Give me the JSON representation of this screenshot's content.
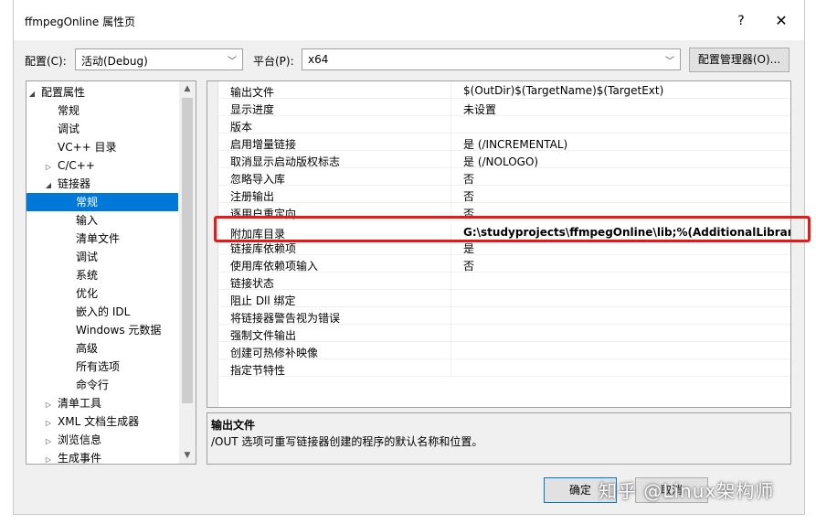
{
  "window": {
    "title": "ffmpegOnline 属性页",
    "help_glyph": "?",
    "close_glyph": "✕"
  },
  "config_bar": {
    "config_label": "配置(C):",
    "config_value": "活动(Debug)",
    "platform_label": "平台(P):",
    "platform_value": "x64",
    "manager_button": "配置管理器(O)..."
  },
  "tree": {
    "items": [
      {
        "label": "配置属性",
        "toggle": "◢"
      },
      {
        "label": "常规",
        "toggle": ""
      },
      {
        "label": "调试",
        "toggle": ""
      },
      {
        "label": "VC++ 目录",
        "toggle": ""
      },
      {
        "label": "C/C++",
        "toggle": "▷"
      },
      {
        "label": "链接器",
        "toggle": "◢"
      },
      {
        "label": "常规",
        "toggle": ""
      },
      {
        "label": "输入",
        "toggle": ""
      },
      {
        "label": "清单文件",
        "toggle": ""
      },
      {
        "label": "调试",
        "toggle": ""
      },
      {
        "label": "系统",
        "toggle": ""
      },
      {
        "label": "优化",
        "toggle": ""
      },
      {
        "label": "嵌入的 IDL",
        "toggle": ""
      },
      {
        "label": "Windows 元数据",
        "toggle": ""
      },
      {
        "label": "高级",
        "toggle": ""
      },
      {
        "label": "所有选项",
        "toggle": ""
      },
      {
        "label": "命令行",
        "toggle": ""
      },
      {
        "label": "清单工具",
        "toggle": "▷"
      },
      {
        "label": "XML 文档生成器",
        "toggle": "▷"
      },
      {
        "label": "浏览信息",
        "toggle": "▷"
      },
      {
        "label": "生成事件",
        "toggle": "▷"
      }
    ],
    "selected_index": 6
  },
  "properties": {
    "rows": [
      {
        "name": "输出文件",
        "value": "$(OutDir)$(TargetName)$(TargetExt)"
      },
      {
        "name": "显示进度",
        "value": "未设置"
      },
      {
        "name": "版本",
        "value": ""
      },
      {
        "name": "启用增量链接",
        "value": "是 (/INCREMENTAL)"
      },
      {
        "name": "取消显示启动版权标志",
        "value": "是 (/NOLOGO)"
      },
      {
        "name": "忽略导入库",
        "value": "否"
      },
      {
        "name": "注册输出",
        "value": "否"
      },
      {
        "name": "逐用户重定向",
        "value": "否"
      },
      {
        "name": "附加库目录",
        "value": "G:\\studyprojects\\ffmpegOnline\\lib;%(AdditionalLibraryDire"
      },
      {
        "name": "链接库依赖项",
        "value": "是"
      },
      {
        "name": "使用库依赖项输入",
        "value": "否"
      },
      {
        "name": "链接状态",
        "value": ""
      },
      {
        "name": "阻止 Dll 绑定",
        "value": ""
      },
      {
        "name": "将链接器警告视为错误",
        "value": ""
      },
      {
        "name": "强制文件输出",
        "value": ""
      },
      {
        "name": "创建可热修补映像",
        "value": ""
      },
      {
        "name": "指定节特性",
        "value": ""
      }
    ],
    "highlighted_index": 8
  },
  "description": {
    "title": "输出文件",
    "text": "/OUT 选项可重写链接器创建的程序的默认名称和位置。"
  },
  "footer": {
    "ok_button": "确定",
    "cancel_button": "取消"
  },
  "watermark": "知乎 @Linux架构师",
  "colors": {
    "selection": "#0078d7",
    "highlight_box": "#e21b1b"
  }
}
